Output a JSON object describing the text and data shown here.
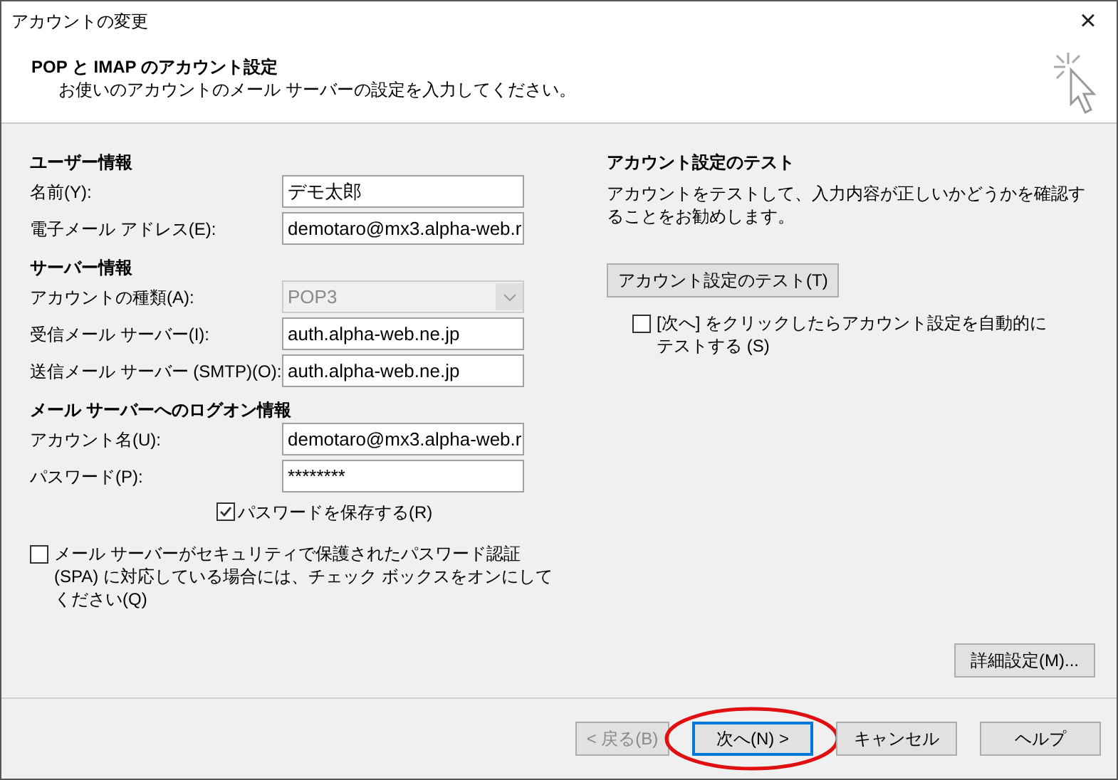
{
  "window": {
    "title": "アカウントの変更",
    "close": "×"
  },
  "header": {
    "title": "POP と IMAP のアカウント設定",
    "subtitle": "お使いのアカウントのメール サーバーの設定を入力してください。"
  },
  "left": {
    "sections": [
      {
        "title": "ユーザー情報",
        "fields": [
          {
            "kind": "text",
            "label": "名前(Y):",
            "value": "デモ太郎",
            "disabled": false
          },
          {
            "kind": "text",
            "label": "電子メール アドレス(E):",
            "value": "demotaro@mx3.alpha-web.r",
            "disabled": false
          }
        ]
      },
      {
        "title": "サーバー情報",
        "fields": [
          {
            "kind": "select",
            "label": "アカウントの種類(A):",
            "value": "POP3",
            "disabled": true
          },
          {
            "kind": "text",
            "label": "受信メール サーバー(I):",
            "value": "auth.alpha-web.ne.jp",
            "disabled": false
          },
          {
            "kind": "text",
            "label": "送信メール サーバー (SMTP)(O):",
            "value": "auth.alpha-web.ne.jp",
            "disabled": false
          }
        ]
      },
      {
        "title": "メール サーバーへのログオン情報",
        "fields": [
          {
            "kind": "text",
            "label": "アカウント名(U):",
            "value": "demotaro@mx3.alpha-web.r",
            "disabled": false
          },
          {
            "kind": "text",
            "label": "パスワード(P):",
            "value": "********",
            "disabled": false
          }
        ]
      }
    ],
    "save_password": {
      "label": "パスワードを保存する(R)",
      "checked": true
    },
    "spa": {
      "label": "メール サーバーがセキュリティで保護されたパスワード認証 (SPA) に対応している場合には、チェック ボックスをオンにしてください(Q)",
      "checked": false
    }
  },
  "right": {
    "title": "アカウント設定のテスト",
    "description": "アカウントをテストして、入力内容が正しいかどうかを確認することをお勧めします。",
    "test_button": "アカウント設定のテスト(T)",
    "auto_test": {
      "label": "[次へ] をクリックしたらアカウント設定を自動的にテストする (S)",
      "checked": false
    },
    "advanced_button": "詳細設定(M)..."
  },
  "footer": {
    "buttons": [
      {
        "label": "< 戻る(B)",
        "disabled": true,
        "focused": false
      },
      {
        "label": "次へ(N) >",
        "disabled": false,
        "focused": true
      },
      {
        "label": "キャンセル",
        "disabled": false,
        "focused": false
      },
      {
        "label": "ヘルプ",
        "disabled": false,
        "focused": false
      }
    ]
  }
}
